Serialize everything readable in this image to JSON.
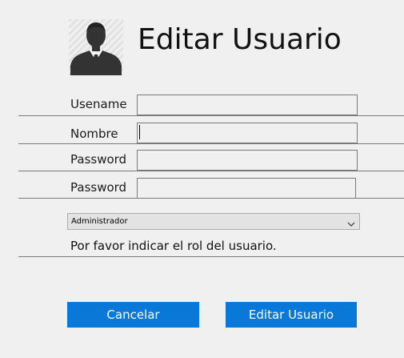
{
  "header": {
    "title": "Editar Usuario",
    "avatar_icon": "user-suit-icon"
  },
  "form": {
    "username": {
      "label": "Usename",
      "value": ""
    },
    "name": {
      "label": "Nombre",
      "value": ""
    },
    "password": {
      "label": "Password",
      "value": ""
    },
    "password_confirm": {
      "label": "Password",
      "value": ""
    },
    "role": {
      "selected": "Administrador",
      "chevron_icon": "chevron-down-icon"
    },
    "role_hint": "Por favor indicar el rol del usuario."
  },
  "buttons": {
    "cancel": "Cancelar",
    "submit": "Editar Usuario"
  },
  "colors": {
    "background": "#f0f0f0",
    "button": "#0a78d7",
    "button_text": "#ffffff"
  }
}
